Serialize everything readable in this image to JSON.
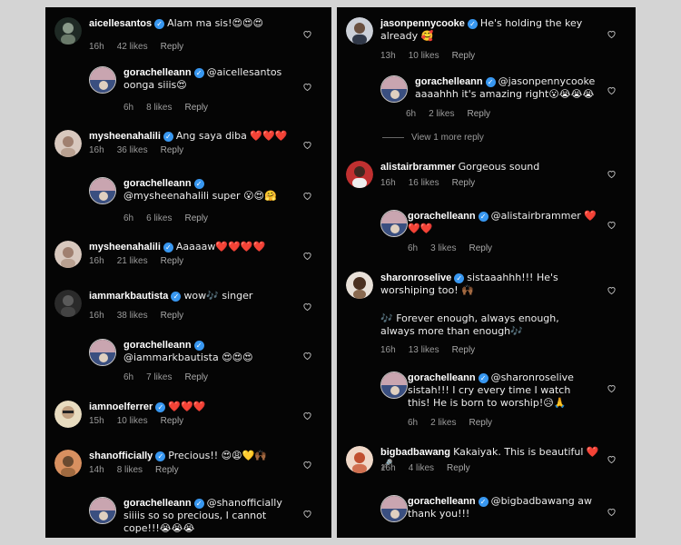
{
  "left_column": [
    {
      "username": "aicellesantos",
      "text": "Alam ma sis!😍😍😍",
      "time": "16h",
      "likes": "42 likes",
      "reply": "Reply",
      "is_reply": false,
      "avatar_color": "#8a9a8a"
    },
    {
      "username": "gorachelleann",
      "text": "@aicellesantos oonga siiis😍",
      "time": "6h",
      "likes": "8 likes",
      "reply": "Reply",
      "is_reply": true,
      "avatar_color": "#5a6fa0"
    },
    {
      "username": "mysheenahalili",
      "text": "Ang saya diba ❤️❤️❤️",
      "time": "16h",
      "likes": "36 likes",
      "reply": "Reply",
      "is_reply": false,
      "avatar_color": "#b3a096"
    },
    {
      "username": "gorachelleann",
      "text": "@mysheenahalili super 😮😍🤗",
      "time": "6h",
      "likes": "6 likes",
      "reply": "Reply",
      "is_reply": true,
      "avatar_color": "#5a6fa0"
    },
    {
      "username": "mysheenahalili",
      "text": "Aaaaaw❤️❤️❤️❤️",
      "time": "16h",
      "likes": "21 likes",
      "reply": "Reply",
      "is_reply": false,
      "avatar_color": "#b3a096"
    },
    {
      "username": "iammarkbautista",
      "text": "wow🎶 singer",
      "time": "16h",
      "likes": "38 likes",
      "reply": "Reply",
      "is_reply": false,
      "avatar_color": "#3a3a3a"
    },
    {
      "username": "gorachelleann",
      "text": "@iammarkbautista 😍😍😍",
      "time": "6h",
      "likes": "7 likes",
      "reply": "Reply",
      "is_reply": true,
      "avatar_color": "#5a6fa0"
    },
    {
      "username": "iamnoelferrer",
      "text": "❤️❤️❤️",
      "time": "15h",
      "likes": "10 likes",
      "reply": "Reply",
      "is_reply": false,
      "avatar_color": "#d9c9a0"
    },
    {
      "username": "shanofficially",
      "text": "Precious!! 😍😩💛🙌🏾",
      "time": "14h",
      "likes": "8 likes",
      "reply": "Reply",
      "is_reply": false,
      "avatar_color": "#c08a60"
    },
    {
      "username": "gorachelleann",
      "text": "@shanofficially siiiis so so precious, I cannot cope!!!😭😭😭",
      "time": "",
      "likes": "",
      "reply": "",
      "is_reply": true,
      "avatar_color": "#5a6fa0"
    }
  ],
  "right_column": [
    {
      "username": "jasonpennycooke",
      "text": "He's holding the key already 🥰",
      "time": "13h",
      "likes": "10 likes",
      "reply": "Reply",
      "is_reply": false,
      "avatar_color": "#7a7a8a"
    },
    {
      "username": "gorachelleann",
      "text": "@jasonpennycooke aaaahhh it's amazing right😮😭😭😭",
      "time": "6h",
      "likes": "2 likes",
      "reply": "Reply",
      "is_reply": true,
      "avatar_color": "#5a6fa0"
    },
    {
      "username": "alistairbrammer",
      "text": "Gorgeous sound",
      "time": "16h",
      "likes": "16 likes",
      "reply": "Reply",
      "is_reply": false,
      "avatar_color": "#a05050"
    },
    {
      "username": "gorachelleann",
      "text": "@alistairbrammer ❤️❤️❤️",
      "time": "6h",
      "likes": "3 likes",
      "reply": "Reply",
      "is_reply": true,
      "avatar_color": "#5a6fa0"
    },
    {
      "username": "sharonroselive",
      "text": "sistaaahhh!!! He's worshiping too! 🙌🏾",
      "text2": "🎶 Forever enough, always enough, always more than enough🎶",
      "time": "16h",
      "likes": "13 likes",
      "reply": "Reply",
      "is_reply": false,
      "avatar_color": "#7a5a40"
    },
    {
      "username": "gorachelleann",
      "text": "@sharonroselive sistah!!! I cry every time I watch this! He is born to worship!😥🙏",
      "time": "6h",
      "likes": "2 likes",
      "reply": "Reply",
      "is_reply": true,
      "avatar_color": "#5a6fa0"
    },
    {
      "username": "bigbadbawang",
      "text": "Kakaiyak. This is beautiful ❤️🎤",
      "time": "16h",
      "likes": "4 likes",
      "reply": "Reply",
      "is_reply": false,
      "avatar_color": "#c06a40"
    },
    {
      "username": "gorachelleann",
      "text": "@bigbadbawang aw thank you!!!",
      "time": "",
      "likes": "",
      "reply": "",
      "is_reply": true,
      "avatar_color": "#5a6fa0"
    }
  ],
  "view_more": "View 1 more reply",
  "verified_glyph": "✓"
}
